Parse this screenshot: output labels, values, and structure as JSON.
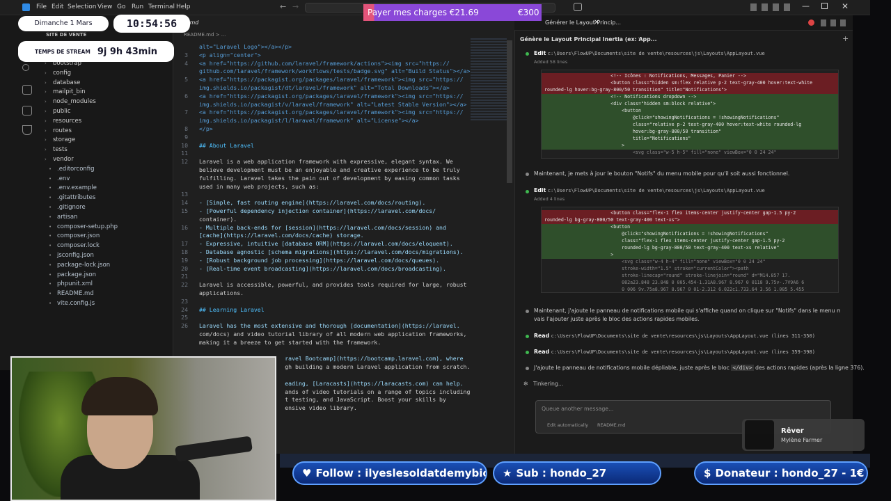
{
  "menu": [
    "File",
    "Edit",
    "Selection",
    "View",
    "Go",
    "Run",
    "Terminal",
    "Help"
  ],
  "overlay": {
    "date": "Dimanche 1 Mars",
    "time": "10:54:56",
    "stream_label": "TEMPS DE STREAM",
    "stream_time": "9j 9h 43min",
    "charges_label": "Payer mes charges €21.69",
    "charges_goal": "€300",
    "follow": "Follow : ilyeslesoldatdemybios",
    "sub": "Sub : hondo_27",
    "donor": "Donateur : hondo_27 - 1€",
    "music_title": "Rêver",
    "music_artist": "Mylène Farmer"
  },
  "explorer": {
    "section": "SITE DE VENTE",
    "items": [
      {
        "label": "bootstrap",
        "type": "folder"
      },
      {
        "label": "config",
        "type": "folder"
      },
      {
        "label": "database",
        "type": "folder"
      },
      {
        "label": "mailpit_bin",
        "type": "folder"
      },
      {
        "label": "node_modules",
        "type": "folder"
      },
      {
        "label": "public",
        "type": "folder"
      },
      {
        "label": "resources",
        "type": "folder"
      },
      {
        "label": "routes",
        "type": "folder"
      },
      {
        "label": "storage",
        "type": "folder"
      },
      {
        "label": "tests",
        "type": "folder"
      },
      {
        "label": "vendor",
        "type": "folder"
      },
      {
        "label": ".editorconfig",
        "type": "file"
      },
      {
        "label": ".env",
        "type": "file"
      },
      {
        "label": ".env.example",
        "type": "file"
      },
      {
        "label": ".gitattributes",
        "type": "file"
      },
      {
        "label": ".gitignore",
        "type": "file"
      },
      {
        "label": "artisan",
        "type": "file"
      },
      {
        "label": "composer-setup.php",
        "type": "file"
      },
      {
        "label": "composer.json",
        "type": "file"
      },
      {
        "label": "composer.lock",
        "type": "file"
      },
      {
        "label": "jsconfig.json",
        "type": "file"
      },
      {
        "label": "package-lock.json",
        "type": "file"
      },
      {
        "label": "package.json",
        "type": "file"
      },
      {
        "label": "phpunit.xml",
        "type": "file"
      },
      {
        "label": "README.md",
        "type": "file"
      },
      {
        "label": "vite.config.js",
        "type": "file"
      }
    ]
  },
  "editor": {
    "tab": "ME.md",
    "breadcrumb": "README.md > ...",
    "lines": [
      {
        "n": "",
        "t": "alt=\"Laravel Logo\"></a></p>"
      },
      {
        "n": "3",
        "t": "<p align=\"center\">"
      },
      {
        "n": "4",
        "t": "<a href=\"https://github.com/laravel/framework/actions\"><img src=\"https://"
      },
      {
        "n": "",
        "t": "github.com/laravel/framework/workflows/tests/badge.svg\" alt=\"Build Status\"></a>"
      },
      {
        "n": "5",
        "t": "<a href=\"https://packagist.org/packages/laravel/framework\"><img src=\"https://"
      },
      {
        "n": "",
        "t": "img.shields.io/packagist/dt/laravel/framework\" alt=\"Total Downloads\"></a>"
      },
      {
        "n": "6",
        "t": "<a href=\"https://packagist.org/packages/laravel/framework\"><img src=\"https://"
      },
      {
        "n": "",
        "t": "img.shields.io/packagist/v/laravel/framework\" alt=\"Latest Stable Version\"></a>"
      },
      {
        "n": "7",
        "t": "<a href=\"https://packagist.org/packages/laravel/framework\"><img src=\"https://"
      },
      {
        "n": "",
        "t": "img.shields.io/packagist/l/laravel/framework\" alt=\"License\"></a>"
      },
      {
        "n": "8",
        "t": "</p>"
      },
      {
        "n": "9",
        "t": ""
      },
      {
        "n": "10",
        "t": "## About Laravel"
      },
      {
        "n": "11",
        "t": ""
      },
      {
        "n": "12",
        "t": "Laravel is a web application framework with expressive, elegant syntax. We"
      },
      {
        "n": "",
        "t": "believe development must be an enjoyable and creative experience to be truly"
      },
      {
        "n": "",
        "t": "fulfilling. Laravel takes the pain out of development by easing common tasks"
      },
      {
        "n": "",
        "t": "used in many web projects, such as:"
      },
      {
        "n": "13",
        "t": ""
      },
      {
        "n": "14",
        "t": "- [Simple, fast routing engine](https://laravel.com/docs/routing)."
      },
      {
        "n": "15",
        "t": "- [Powerful dependency injection container](https://laravel.com/docs/"
      },
      {
        "n": "",
        "t": "container)."
      },
      {
        "n": "16",
        "t": "- Multiple back-ends for [session](https://laravel.com/docs/session) and"
      },
      {
        "n": "",
        "t": "[cache](https://laravel.com/docs/cache) storage."
      },
      {
        "n": "17",
        "t": "- Expressive, intuitive [database ORM](https://laravel.com/docs/eloquent)."
      },
      {
        "n": "18",
        "t": "- Database agnostic [schema migrations](https://laravel.com/docs/migrations)."
      },
      {
        "n": "19",
        "t": "- [Robust background job processing](https://laravel.com/docs/queues)."
      },
      {
        "n": "20",
        "t": "- [Real-time event broadcasting](https://laravel.com/docs/broadcasting)."
      },
      {
        "n": "21",
        "t": ""
      },
      {
        "n": "22",
        "t": "Laravel is accessible, powerful, and provides tools required for large, robust"
      },
      {
        "n": "",
        "t": "applications."
      },
      {
        "n": "23",
        "t": ""
      },
      {
        "n": "24",
        "t": "## Learning Laravel"
      },
      {
        "n": "25",
        "t": ""
      },
      {
        "n": "26",
        "t": "Laravel has the most extensive and thorough [documentation](https://laravel."
      },
      {
        "n": "",
        "t": "com/docs) and video tutorial library of all modern web application frameworks,"
      },
      {
        "n": "",
        "t": "making it a breeze to get started with the framework."
      },
      {
        "n": "",
        "t": ""
      },
      {
        "n": "",
        "t": "                         ravel Bootcamp](https://bootcamp.laravel.com), where"
      },
      {
        "n": "",
        "t": "                         gh building a modern Laravel application from scratch."
      },
      {
        "n": "",
        "t": ""
      },
      {
        "n": "",
        "t": "                         eading, [Laracasts](https://laracasts.com) can help."
      },
      {
        "n": "",
        "t": "                         ands of video tutorials on a range of topics including"
      },
      {
        "n": "",
        "t": "                         t testing, and JavaScript. Boost your skills by"
      },
      {
        "n": "",
        "t": "                         ensive video library."
      }
    ]
  },
  "chat": {
    "tab_title": "Générer le Layout Princip...",
    "session_title": "Génère le Layout Principal Inertia (ex: App...",
    "edit_label": "Edit",
    "edit1_path": "c:\\Users\\FlowUP\\Documents\\site de vente\\resources\\js\\Layouts\\AppLayout.vue",
    "edit1_added": "Added 58 lines",
    "diff1": [
      {
        "c": "r",
        "t": "                        <!-- Icônes : Notifications, Messages, Panier -->"
      },
      {
        "c": "r",
        "t": "                        <button class=\"hidden sm:flex relative p-2 text-gray-400 hover:text-white"
      },
      {
        "c": "r",
        "t": "rounded-lg hover:bg-gray-800/50 transition\" title=\"Notifications\">"
      },
      {
        "c": "g",
        "t": "                        <!-- Notifications dropdown -->"
      },
      {
        "c": "g",
        "t": "                        <div class=\"hidden sm:block relative\">"
      },
      {
        "c": "g",
        "t": "                            <button"
      },
      {
        "c": "g",
        "t": "                                @click=\"showingNotifications = !showingNotifications\""
      },
      {
        "c": "g",
        "t": "                                class=\"relative p-2 text-gray-400 hover:text-white rounded-lg"
      },
      {
        "c": "g",
        "t": "                                hover:bg-gray-800/50 transition\""
      },
      {
        "c": "g",
        "t": "                                title=\"Notifications\""
      },
      {
        "c": "g",
        "t": "                            >"
      },
      {
        "c": "n",
        "t": "                                <svg class=\"w-5 h-5\" fill=\"none\" viewBox=\"0 0 24 24\""
      }
    ],
    "msg1": "Maintenant, je mets à jour le bouton \"Notifs\" du menu mobile pour qu'il soit aussi fonctionnel.",
    "edit2_path": "c:\\Users\\FlowUP\\Documents\\site de vente\\resources\\js\\Layouts\\AppLayout.vue",
    "edit2_added": "Added 4 lines",
    "diff2": [
      {
        "c": "r",
        "t": "                        <button class=\"flex-1 flex items-center justify-center gap-1.5 py-2"
      },
      {
        "c": "r",
        "t": "rounded-lg bg-gray-800/50 text-gray-400 text-xs\">"
      },
      {
        "c": "g",
        "t": "                        <button"
      },
      {
        "c": "g",
        "t": "                            @click=\"showingNotifications = !showingNotifications\""
      },
      {
        "c": "g",
        "t": "                            class=\"flex-1 flex items-center justify-center gap-1.5 py-2"
      },
      {
        "c": "g",
        "t": "                            rounded-lg bg-gray-800/50 text-gray-400 text-xs relative\""
      },
      {
        "c": "g",
        "t": "                        >"
      },
      {
        "c": "n",
        "t": "                            <svg class=\"w-4 h-4\" fill=\"none\" viewBox=\"0 0 24 24\""
      },
      {
        "c": "n",
        "t": "                            stroke-width=\"1.5\" stroke=\"currentColor\"><path"
      },
      {
        "c": "n",
        "t": "                            stroke-linecap=\"round\" stroke-linejoin=\"round\" d=\"M14.857 17."
      },
      {
        "c": "n",
        "t": "                            082a23.848 23.848 0 005.454-1.31A8.967 8.967 0 0118 9.75v-.7V9A6 6"
      },
      {
        "c": "n",
        "t": "                            0 006 9v.75a8.967 8.967 0 01-2.312 6.022c1.733.64 3.56 1.085 5.455"
      }
    ],
    "msg2_line1": "Maintenant, j'ajoute le panneau de notifications mobile qui s'affiche quand on clique sur \"Notifs\" dans le menu mobile. Je",
    "msg2_line2": "vais l'ajouter juste après le bloc des actions rapides mobiles.",
    "read_label": "Read",
    "read1_path": "c:\\Users\\FlowUP\\Documents\\site de vente\\resources\\js\\Layouts\\AppLayout.vue (lines 311-350)",
    "read2_path": "c:\\Users\\FlowUP\\Documents\\site de vente\\resources\\js\\Layouts\\AppLayout.vue (lines 359-398)",
    "msg3_a": "J'ajoute le panneau de notifications mobile dépliable, juste après le bloc",
    "msg3_code": "</div>",
    "msg3_b": "des actions rapides (après la ligne 376).",
    "status": "Tinkering...",
    "queue_placeholder": "Queue another message...",
    "queue_mode": "Edit automatically",
    "queue_file": "README.md"
  }
}
